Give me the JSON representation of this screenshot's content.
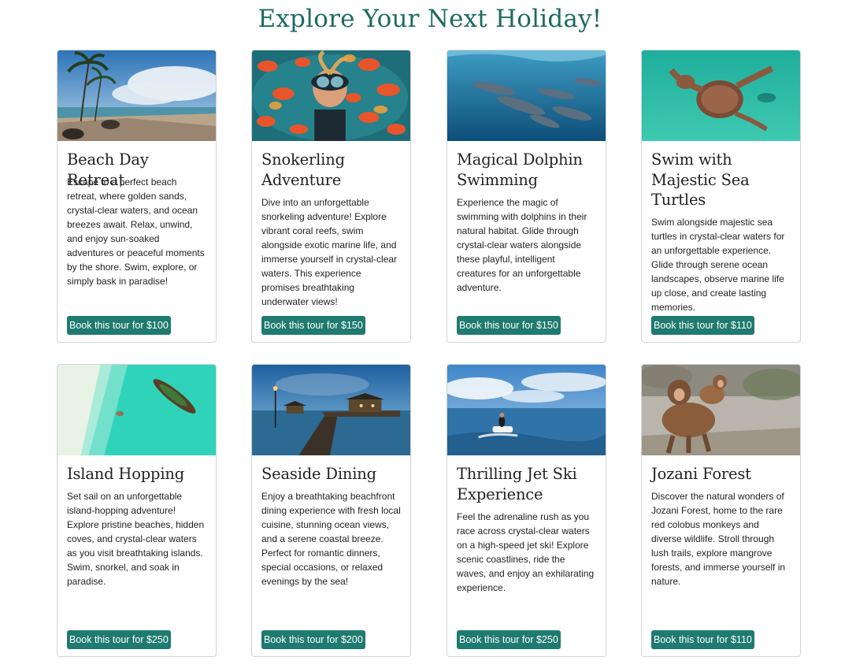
{
  "page": {
    "title": "Explore Your Next Holiday!"
  },
  "tours": [
    {
      "title": "Beach Day Retreat",
      "description": "Escape to a perfect beach retreat, where golden sands, crystal-clear waters, and ocean breezes await. Relax, unwind, and enjoy sun-soaked adventures or peaceful moments by the shore. Swim, explore, or simply bask in paradise!",
      "button": "Book this tour for $100",
      "image": "beach-with-palms-photo"
    },
    {
      "title": "Snokerling Adventure",
      "description": "Dive into an unforgettable snorkeling adventure! Explore vibrant coral reefs, swim alongside exotic marine life, and immerse yourself in crystal-clear waters. This experience promises breathtaking underwater views!",
      "button": "Book this tour for $150",
      "image": "snorkeler-with-fish-photo"
    },
    {
      "title": "Magical Dolphin Swimming",
      "description": "Experience the magic of swimming with dolphins in their natural habitat. Glide through crystal-clear waters alongside these playful, intelligent creatures for an unforgettable adventure.",
      "button": "Book this tour for $150",
      "image": "dolphins-underwater-photo"
    },
    {
      "title": "Swim with Majestic Sea Turtles",
      "description": "Swim alongside majestic sea turtles in crystal-clear waters for an unforgettable experience. Glide through serene ocean landscapes, observe marine life up close, and create lasting memories.",
      "button": "Book this tour for $110",
      "image": "sea-turtle-underwater-photo"
    },
    {
      "title": "Island Hopping",
      "description": "Set sail on an unforgettable island-hopping adventure! Explore pristine beaches, hidden coves, and crystal-clear waters as you visit breathtaking islands. Swim, snorkel, and soak in paradise.",
      "button": "Book this tour for $250",
      "image": "boat-on-turquoise-water-photo"
    },
    {
      "title": "Seaside Dining",
      "description": "Enjoy a breathtaking beachfront dining experience with fresh local cuisine, stunning ocean views, and a serene coastal breeze. Perfect for romantic dinners, special occasions, or relaxed evenings by the sea!",
      "button": "Book this tour for $200",
      "image": "pier-at-dusk-photo"
    },
    {
      "title": "Thrilling Jet Ski Experience",
      "description": "Feel the adrenaline rush as you race across crystal-clear waters on a high-speed jet ski! Explore scenic coastlines, ride the waves, and enjoy an exhilarating experience.",
      "button": "Book this tour for $250",
      "image": "jet-ski-photo"
    },
    {
      "title": "Jozani Forest",
      "description": "Discover the natural wonders of Jozani Forest, home to the rare red colobus monkeys and diverse wildlife. Stroll through lush trails, explore mangrove forests, and immerse yourself in nature.",
      "button": "Book this tour for $110",
      "image": "monkeys-photo"
    }
  ]
}
